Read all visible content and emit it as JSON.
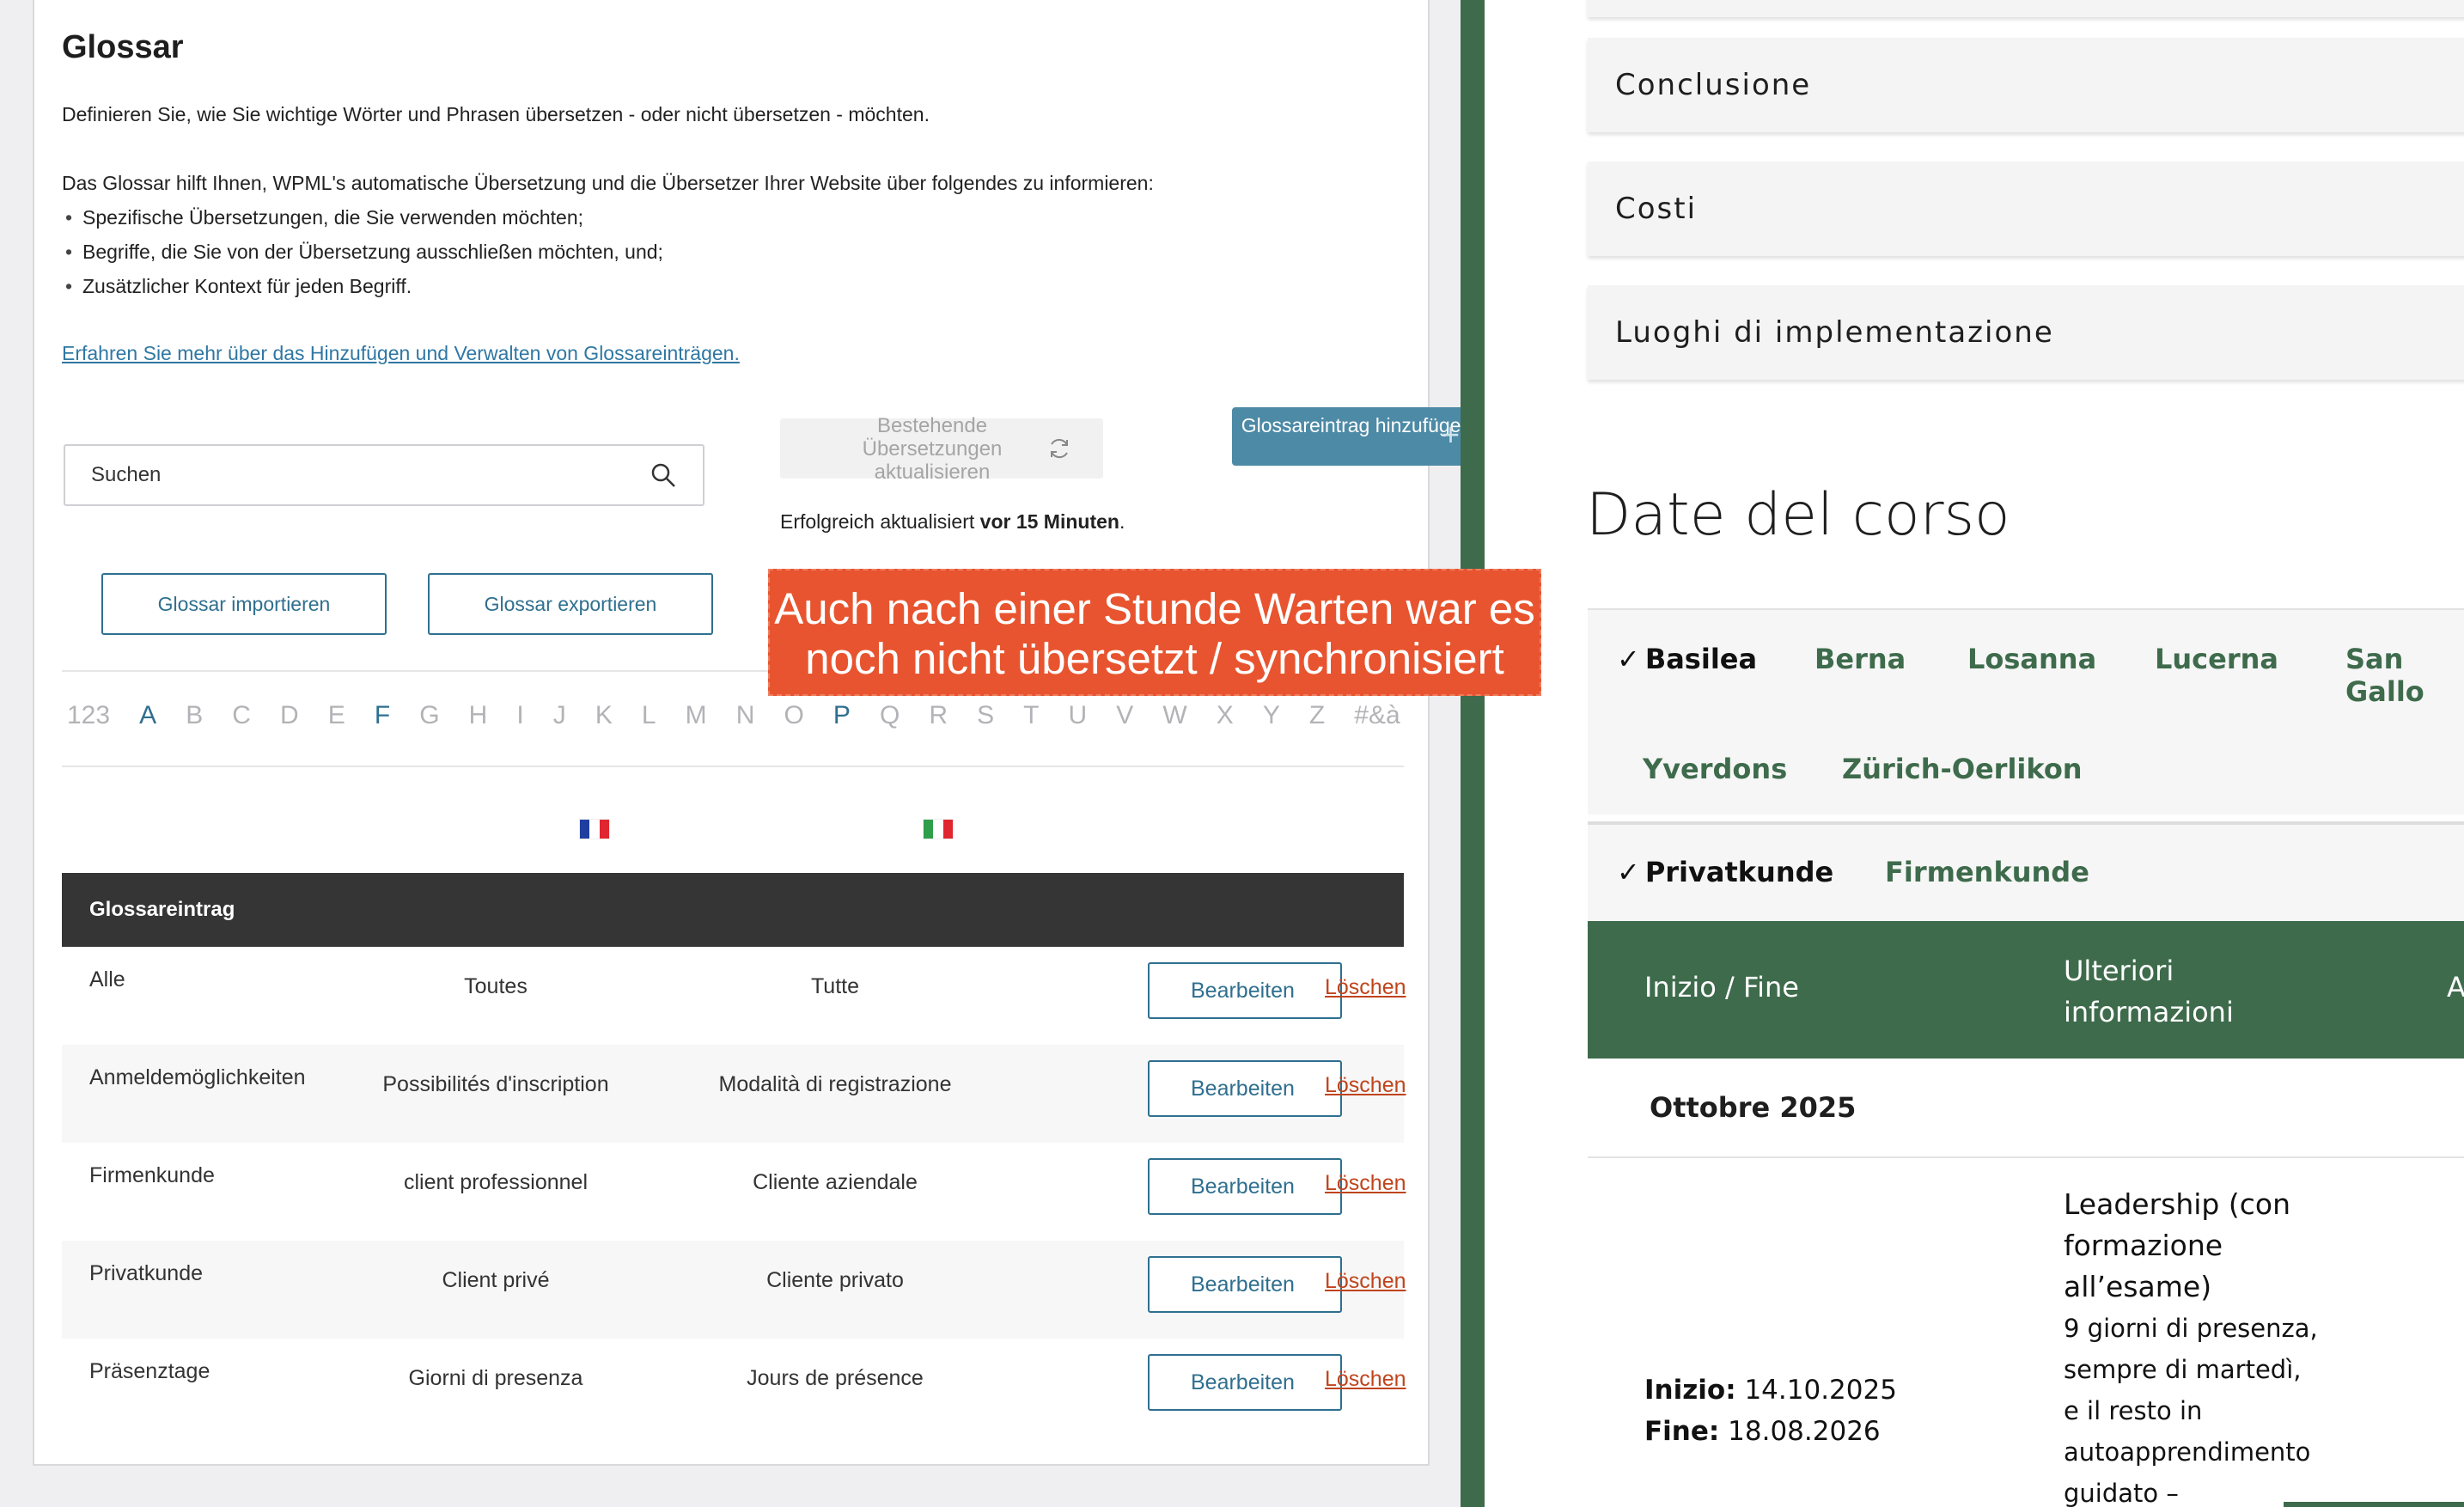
{
  "glossary": {
    "title": "Glossar",
    "intro": "Definieren Sie, wie Sie wichtige Wörter und Phrasen übersetzen - oder nicht übersetzen - möchten.",
    "lead": "Das Glossar hilft Ihnen, WPML's automatische Übersetzung und die Übersetzer Ihrer Website über folgendes zu informieren:",
    "bullets": [
      "Spezifische Übersetzungen, die Sie verwenden möchten;",
      "Begriffe, die Sie von der Übersetzung ausschließen möchten, und;",
      "Zusätzlicher Kontext für jeden Begriff."
    ],
    "learn_link": "Erfahren Sie mehr über das Hinzufügen und Verwalten von Glossareinträgen.",
    "search_placeholder": "Suchen",
    "update_button": "Bestehende Übersetzungen aktualisieren",
    "add_button": "Glossareintrag hinzufügen",
    "status_prefix": "Erfolgreich aktualisiert",
    "status_bold": "vor 15 Minuten",
    "status_suffix": ".",
    "import_button": "Glossar importieren",
    "export_button": "Glossar exportieren",
    "alphabet": [
      "123",
      "A",
      "B",
      "C",
      "D",
      "E",
      "F",
      "G",
      "H",
      "I",
      "J",
      "K",
      "L",
      "M",
      "N",
      "O",
      "P",
      "Q",
      "R",
      "S",
      "T",
      "U",
      "V",
      "W",
      "X",
      "Y",
      "Z",
      "#&à"
    ],
    "active_letters": [
      "A",
      "F",
      "P"
    ],
    "table_header": "Glossareintrag",
    "edit_label": "Bearbeiten",
    "delete_label": "Löschen",
    "rows": [
      {
        "term": "Alle",
        "fr": "Toutes",
        "it": "Tutte"
      },
      {
        "term": "Anmeldemöglichkeiten",
        "fr": "Possibilités d'inscription",
        "it": "Modalità di registrazione"
      },
      {
        "term": "Firmenkunde",
        "fr": "client professionnel",
        "it": "Cliente aziendale"
      },
      {
        "term": "Privatkunde",
        "fr": "Client privé",
        "it": "Cliente privato"
      },
      {
        "term": "Präsenztage",
        "fr": "Giorni di presenza",
        "it": "Jours de présence"
      }
    ]
  },
  "callout": {
    "line1": "Auch nach einer Stunde Warten war es",
    "line2": "noch nicht übersetzt / synchronisiert"
  },
  "site": {
    "accordions": [
      "Conclusione",
      "Costi",
      "Luoghi di implementazione"
    ],
    "dates_heading": "Date del corso",
    "cities": [
      "Basilea",
      "Berna",
      "Losanna",
      "Lucerna",
      "San Gallo",
      "Yverdons",
      "Zürich-Oerlikon"
    ],
    "selected_city": "Basilea",
    "customer_types": [
      "Privatkunde",
      "Firmenkunde"
    ],
    "selected_customer": "Privatkunde",
    "check_mark": "✓",
    "table_headers": [
      "Inizio / Fine",
      "Ulteriori informazioni",
      "An"
    ],
    "month": "Ottobre 2025",
    "start_label": "Inizio:",
    "start_date": "14.10.2025",
    "end_label": "Fine:",
    "end_date": "18.08.2026",
    "info_title_lines": [
      "Leadership (con",
      "formazione",
      "all’esame)"
    ],
    "info_lines": [
      "9 giorni di presenza,",
      "sempre di martedì,",
      "e il resto in",
      "autoapprendimento",
      "guidato –"
    ]
  },
  "colors": {
    "accent_blue": "#2f6f8f",
    "add_button": "#4d8aa6",
    "delete_red": "#c0441c",
    "site_green": "#3e6b4c",
    "callout": "#e8542f"
  }
}
